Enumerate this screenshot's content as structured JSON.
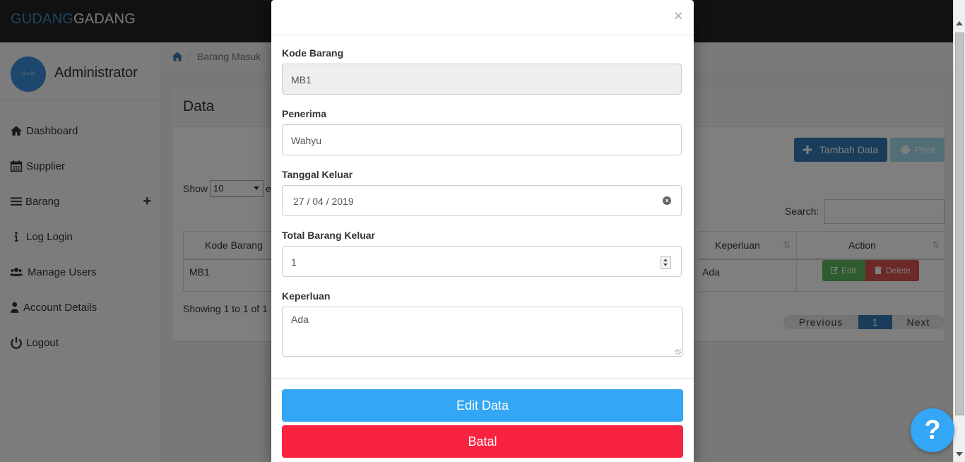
{
  "header": {
    "brand_part1": "GUDANG",
    "brand_part2": "GADANG"
  },
  "sidebar": {
    "avatar_text": "50 x 50",
    "user_name": "Administrator",
    "items": [
      {
        "label": "Dashboard",
        "icon": "home-icon"
      },
      {
        "label": "Supplier",
        "icon": "calendar-icon"
      },
      {
        "label": "Barang",
        "icon": "menu-icon",
        "expand": "+"
      },
      {
        "label": "Log Login",
        "icon": "info-icon"
      },
      {
        "label": "Manage Users",
        "icon": "users-icon"
      },
      {
        "label": "Account Details",
        "icon": "user-icon"
      },
      {
        "label": "Logout",
        "icon": "power-icon"
      }
    ]
  },
  "breadcrumb": {
    "separator": "/",
    "current": "Barang Masuk"
  },
  "panel": {
    "title": "Data",
    "tambah_label": "Tambah Data",
    "print_label": "Print",
    "show_label": "Show",
    "show_value": "10",
    "entries_partial": "e",
    "search_label": "Search:",
    "columns": {
      "kode": "Kode Barang",
      "keperluan": "Keperluan",
      "action": "Action"
    },
    "row": {
      "kode": "MB1",
      "keperluan": "Ada"
    },
    "edit_label": "Edit",
    "delete_label": "Delete",
    "showing_partial": "Showing 1 to 1 of 1",
    "pager": {
      "previous": "Previous",
      "current": "1",
      "next": "Next"
    }
  },
  "modal": {
    "close": "×",
    "fields": {
      "kode_label": "Kode Barang",
      "kode_value": "MB1",
      "penerima_label": "Penerima",
      "penerima_value": "Wahyu",
      "tanggal_label": "Tanggal Keluar",
      "tanggal_value": "27 / 04 / 2019",
      "total_label": "Total Barang Keluar",
      "total_value": "1",
      "keperluan_label": "Keperluan",
      "keperluan_value": "Ada"
    },
    "edit_button": "Edit Data",
    "cancel_button": "Batal"
  },
  "help": {
    "label": "?"
  },
  "colors": {
    "brand_blue": "#3c8dbc",
    "edit_data": "#33a6f5",
    "batal": "#f7233f"
  }
}
